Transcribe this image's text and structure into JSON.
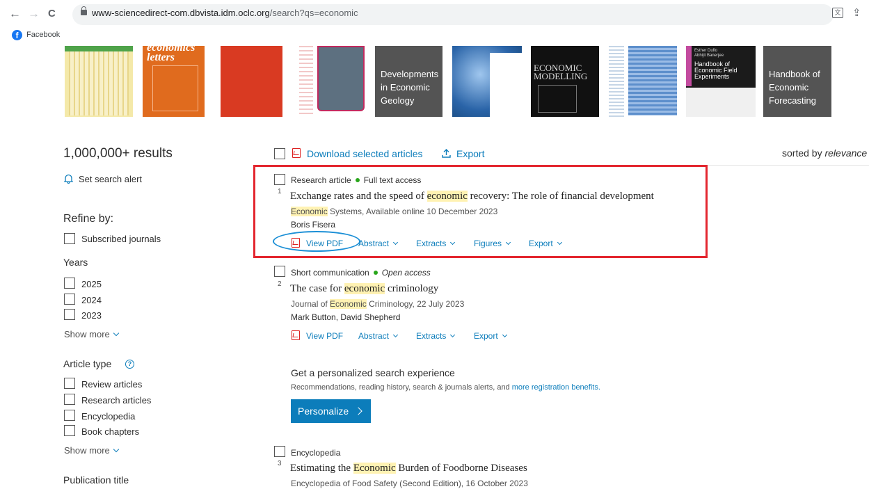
{
  "browser": {
    "url_domain": "www-sciencedirect-com.dbvista.idm.oclc.org",
    "url_path": "/search?qs=economic",
    "back": "←",
    "forward": "→",
    "reload": "C",
    "bookmark_facebook": "Facebook"
  },
  "covers": [
    {
      "name": "cover-1",
      "bg": "#f4e9a9"
    },
    {
      "name": "cover-economics-letters",
      "bg": "#e06b1e",
      "title": "economics letters"
    },
    {
      "name": "cover-3",
      "bg": "#d93a22"
    },
    {
      "name": "cover-4",
      "bg": "#5d7080"
    },
    {
      "name": "cover-developments-economic-geology",
      "bg": "#545454",
      "title_lines": [
        "Developments",
        "in Economic",
        "Geology"
      ]
    },
    {
      "name": "cover-6",
      "bg": "#3a7bc2"
    },
    {
      "name": "cover-economic-modelling",
      "bg": "#111111",
      "title": "ECONOMIC MODELLING"
    },
    {
      "name": "cover-8",
      "bg": "#7fa9d8"
    },
    {
      "name": "cover-handbook-field-experiments",
      "bg": "#f0f0f0",
      "title_lines": [
        "Handbook of",
        "Economic Field",
        "Experiments"
      ],
      "authors": "Esther Duflo Abhijit Banerjee"
    },
    {
      "name": "cover-handbook-economic-forecasting",
      "bg": "#545454",
      "title_lines": [
        "Handbook of",
        "Economic",
        "Forecasting"
      ]
    }
  ],
  "sidebar": {
    "results_count": "1,000,000+ results",
    "set_alert": "Set search alert",
    "refine_by": "Refine by:",
    "subscribed": "Subscribed journals",
    "years_head": "Years",
    "years": [
      "2025",
      "2024",
      "2023"
    ],
    "show_more": "Show more",
    "article_type_head": "Article type",
    "article_types": [
      "Review articles",
      "Research articles",
      "Encyclopedia",
      "Book chapters"
    ],
    "show_more_2": "Show more",
    "publication_title_head": "Publication title"
  },
  "toolbar": {
    "download_selected": "Download selected articles",
    "export": "Export",
    "sorted_by_label": "sorted by",
    "sorted_by_value": "relevance"
  },
  "results": [
    {
      "number": "1",
      "type": "Research article",
      "access": "Full text access",
      "title_pre": "Exchange rates and the speed of ",
      "title_hl": "economic",
      "title_post": " recovery: The role of financial development",
      "source_hl": "Economic",
      "source_post": " Systems, Available online 10 December 2023",
      "authors": "Boris Fisera",
      "actions": [
        "View PDF",
        "Abstract",
        "Extracts",
        "Figures",
        "Export"
      ]
    },
    {
      "number": "2",
      "type": "Short communication",
      "access": "Open access",
      "title_pre": "The case for ",
      "title_hl": "economic",
      "title_post": " criminology",
      "source_pre": "Journal of ",
      "source_hl": "Economic",
      "source_post": " Criminology, 22 July 2023",
      "authors": "Mark Button, David Shepherd",
      "actions": [
        "View PDF",
        "Abstract",
        "Extracts",
        "Export"
      ]
    },
    {
      "number": "3",
      "type": "Encyclopedia",
      "title_pre": "Estimating the ",
      "title_hl": "Economic",
      "title_post": " Burden of Foodborne Diseases",
      "source": "Encyclopedia of Food Safety (Second Edition), 16 October 2023"
    }
  ],
  "promo": {
    "heading": "Get a personalized search experience",
    "body": "Recommendations, reading history, search & journals alerts, and ",
    "link": "more registration benefits.",
    "button": "Personalize"
  },
  "annotations": {
    "highlight_box_color": "#e3262f",
    "circle_color": "#1b8fd6"
  }
}
